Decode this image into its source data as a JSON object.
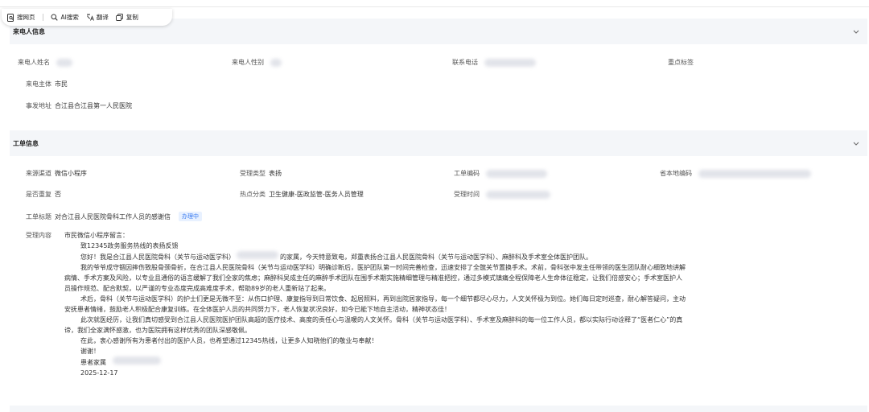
{
  "toolbar": {
    "items": [
      {
        "label": "搜网页",
        "icon": "web-search-icon"
      },
      {
        "label": "AI搜索",
        "icon": "search-icon"
      },
      {
        "label": "翻译",
        "icon": "translate-icon"
      },
      {
        "label": "复制",
        "icon": "copy-icon"
      }
    ]
  },
  "caller": {
    "title": "来电人信息",
    "name_label": "来电人姓名",
    "gender_label": "来电人性别",
    "phone_label": "联系电话",
    "tag_label": "重点标签",
    "subject_label": "来电主体",
    "subject_value": "市民",
    "address_label": "事发地址",
    "address_value": "合江县合江县第一人民医院"
  },
  "ticket": {
    "title": "工单信息",
    "channel_label": "来源渠道",
    "channel_value": "微信小程序",
    "type_label": "受理类型",
    "type_value": "表扬",
    "ticket_no_label": "工单编码",
    "local_no_label": "省本地编码",
    "repeat_label": "是否重复",
    "repeat_value": "否",
    "hot_label": "热点分类",
    "hot_value": "卫生健康-医政监管-医务人员管理",
    "time_label": "受理时间",
    "subject_label": "工单标题",
    "subject_value": "对合江县人民医院骨科工作人员的感谢信",
    "status_badge": "办理中",
    "content_label": "受理内容"
  },
  "content": {
    "lines": [
      "市民微信小程序留言：",
      "致12345政务服务热线的表扬反馈",
      "您好！我是合江县人民医院骨科（关节与运动医学科）",
      "的家属，今天特意致电，郑重表扬合江县人民医院骨科（关节与运动医学科）、麻醉科及手术室全体医护团队。",
      "我的爷爷成守锢因摔伤致股骨颈骨折，在合江县人民医院骨科（关节与运动医学科）明确诊断后，医护团队第一时间完善检查，迅速安排了全髋关节置换手术。术前，骨科张中发主任带领的医生团队耐心细致地讲解",
      "病情、手术方案及风险，以专业且通俗的语言缓解了我们全家的焦虑；麻醉科吴成主任的麻醉手术团队在围手术期实施精细管理与精准把控，通过多模式镇痛全程保障老人生命体征稳定，让我们倍感安心；手术室医护人",
      "员操作规范、配合默契，以严谨的专业态度完成高难度手术，帮助89岁的老人重新站了起来。",
      "术后，骨科（关节与运动医学科）的护士们更是无微不至：从伤口护理、康复指导到日常饮食、起居照料，再到出院居家指导，每一个细节都尽心尽力，人文关怀极为到位。她们每日定时巡查，耐心解答疑问，主动",
      "安抚患者情绪，鼓励老人积极配合康复训练。在全体医护人员的共同努力下，老人恢复状况良好，如今已能下地自主活动，精神状态佳！",
      "此次就医经历，让我们真切感受到合江县人民医院医护团队高超的医疗技术、高度的责任心与温暖的人文关怀。骨科（关节与运动医学科）、手术室及麻醉科的每一位工作人员，都以实际行动诠释了“医者仁心”的真",
      "谛，我们全家满怀感激，也为医院拥有这样优秀的团队深感敬佩。",
      "在此，衷心感谢所有为患者付出的医护人员，也希望通过12345热线，让更多人知晓他们的敬业与奉献！",
      "谢谢！",
      "患者家属",
      "2025-12-17"
    ]
  },
  "colors": {
    "section_bg": "#f4f6f9",
    "badge_bg": "#e8f1ff",
    "badge_text": "#3a7bf0"
  }
}
